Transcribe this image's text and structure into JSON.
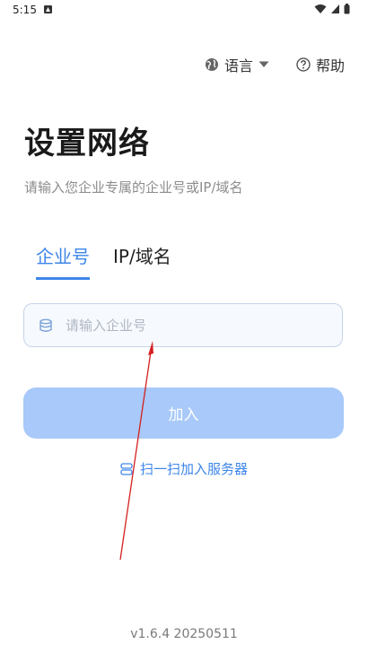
{
  "status_bar": {
    "time": "5:15"
  },
  "header": {
    "language_label": "语言",
    "help_label": "帮助"
  },
  "page": {
    "title": "设置网络",
    "subtitle": "请输入您企业专属的企业号或IP/域名"
  },
  "tabs": [
    {
      "label": "企业号",
      "active": true
    },
    {
      "label": "IP/域名",
      "active": false
    }
  ],
  "form": {
    "enterprise_placeholder": "请输入企业号",
    "join_label": "加入"
  },
  "scan": {
    "label": "扫一扫加入服务器"
  },
  "footer": {
    "version": "v1.6.4 20250511"
  },
  "colors": {
    "accent": "#3d86e9",
    "button_disabled": "#a8c9f9",
    "arrow": "#d42020"
  }
}
